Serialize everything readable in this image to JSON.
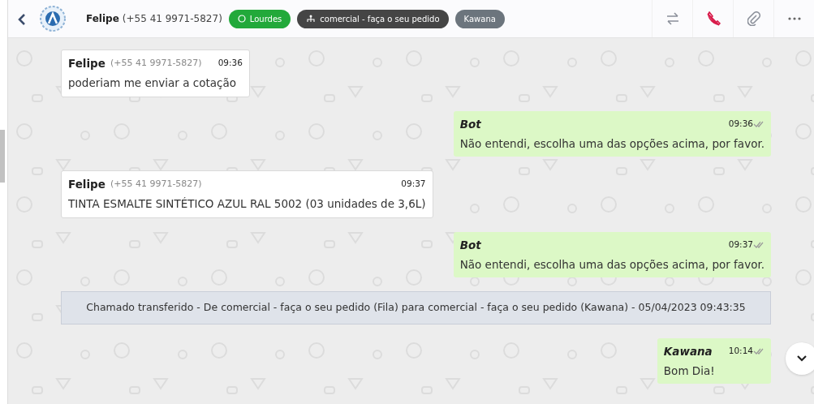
{
  "header": {
    "contact_name": "Felipe",
    "contact_phone": "(+55 41 9971-5827)",
    "tags": [
      {
        "kind": "channel",
        "label": "Lourdes",
        "color": "#22a93a"
      },
      {
        "kind": "queue",
        "label": "comercial - faça o seu pedido",
        "color": "#454545"
      },
      {
        "kind": "agent",
        "label": "Kawana",
        "color": "#6c757d"
      }
    ]
  },
  "messages": [
    {
      "kind": "incoming",
      "sender": "Felipe",
      "phone": "(+55 41 9971-5827)",
      "time": "09:36",
      "text": "poderiam me enviar a cotação"
    },
    {
      "kind": "outgoing",
      "sender": "Bot",
      "time": "09:36",
      "text": "Não entendi, escolha uma das opções acima, por favor."
    },
    {
      "kind": "incoming",
      "sender": "Felipe",
      "phone": "(+55 41 9971-5827)",
      "time": "09:37",
      "text": "TINTA ESMALTE SINTÉTICO AZUL RAL 5002 (03 unidades de 3,6L)"
    },
    {
      "kind": "outgoing",
      "sender": "Bot",
      "time": "09:37",
      "text": "Não entendi, escolha uma das opções acima, por favor."
    },
    {
      "kind": "system",
      "text": "Chamado transferido - De comercial - faça o seu pedido (Fila) para comercial - faça o seu pedido (Kawana) - 05/04/2023 09:43:35"
    },
    {
      "kind": "outgoing",
      "sender": "Kawana",
      "time": "10:14",
      "text": "Bom Dia!"
    }
  ]
}
